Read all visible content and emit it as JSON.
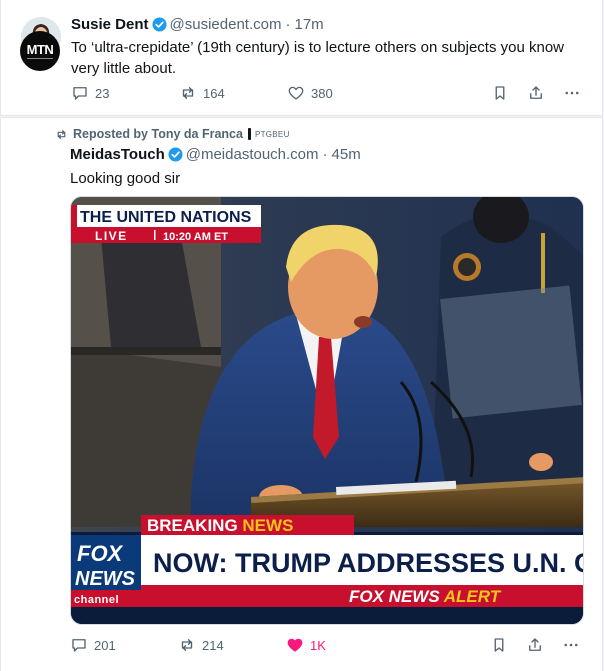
{
  "posts": [
    {
      "name": "Susie Dent",
      "handle": "@susiedent.com",
      "separator": "·",
      "time": "17m",
      "text": "To ‘ultra-crepidate’ (19th century) is to lecture others on subjects you know very little about.",
      "replies": "23",
      "reposts": "164",
      "likes": "380"
    },
    {
      "repost_label": "Reposted by Tony da Franca",
      "repost_badge": "PTGBEU",
      "avatar_text": "MTN",
      "name": "MeidasTouch",
      "handle": "@meidastouch.com",
      "separator": "·",
      "time": "45m",
      "text": "Looking good sir",
      "replies": "201",
      "reposts": "214",
      "likes": "1K",
      "media": {
        "top_banner": "THE UNITED NATIONS",
        "live_label": "LIVE",
        "live_time": "10:20 AM ET",
        "breaking_prefix": "BREAKING",
        "breaking_suffix": "NEWS",
        "headline": "NOW: TRUMP ADDRESSES U.N. GENE",
        "fox_top": "FOX",
        "fox_bottom": "NEWS",
        "fox_channel": "channel",
        "alert_prefix": "FOX NEWS",
        "alert_suffix": "ALERT"
      }
    }
  ],
  "colors": {
    "accent_blue": "#1d9bf0",
    "like_pink": "#f91880",
    "muted": "#536471",
    "chyron_red": "#c8102e",
    "fox_blue": "#0a3a7a",
    "alert_yellow": "#f5c518"
  },
  "icons": {
    "reply": "speech-bubble-icon",
    "repost": "repost-arrows-icon",
    "like": "heart-icon",
    "bookmark": "bookmark-icon",
    "share": "share-upload-icon",
    "more": "ellipsis-icon",
    "verified": "verified-check-icon"
  }
}
